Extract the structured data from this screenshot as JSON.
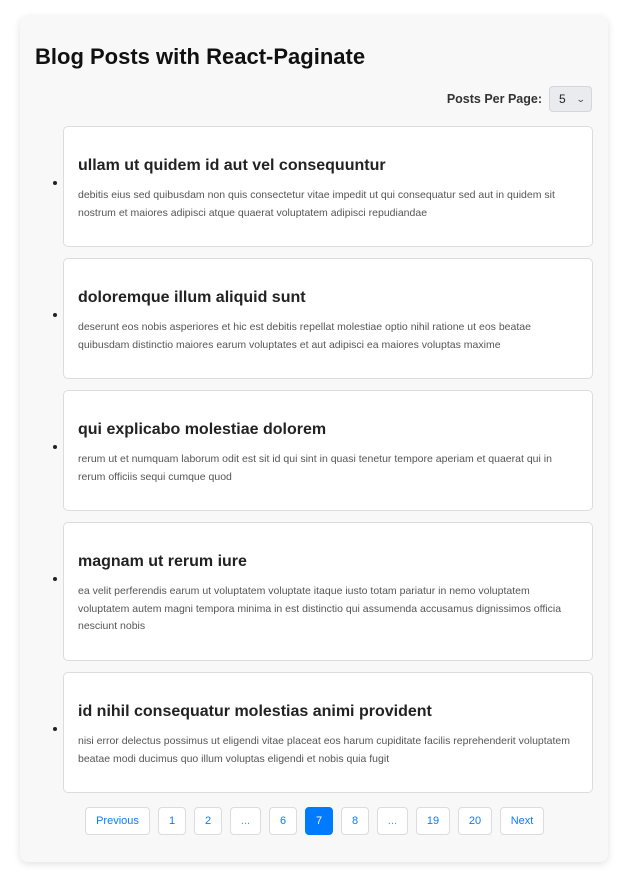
{
  "header": {
    "title": "Blog Posts with React-Paginate"
  },
  "per_page": {
    "label": "Posts Per Page:",
    "selected": "5",
    "chevron_icon": "chevron-down-icon"
  },
  "posts": [
    {
      "title": "ullam ut quidem id aut vel consequuntur",
      "body": "debitis eius sed quibusdam non quis consectetur vitae impedit ut qui consequatur sed aut in quidem sit nostrum et maiores adipisci atque quaerat voluptatem adipisci repudiandae"
    },
    {
      "title": "doloremque illum aliquid sunt",
      "body": "deserunt eos nobis asperiores et hic est debitis repellat molestiae optio nihil ratione ut eos beatae quibusdam distinctio maiores earum voluptates et aut adipisci ea maiores voluptas maxime"
    },
    {
      "title": "qui explicabo molestiae dolorem",
      "body": "rerum ut et numquam laborum odit est sit id qui sint in quasi tenetur tempore aperiam et quaerat qui in rerum officiis sequi cumque quod"
    },
    {
      "title": "magnam ut rerum iure",
      "body": "ea velit perferendis earum ut voluptatem voluptate itaque iusto totam pariatur in nemo voluptatem voluptatem autem magni tempora minima in est distinctio qui assumenda accusamus dignissimos officia nesciunt nobis"
    },
    {
      "title": "id nihil consequatur molestias animi provident",
      "body": "nisi error delectus possimus ut eligendi vitae placeat eos harum cupiditate facilis reprehenderit voluptatem beatae modi ducimus quo illum voluptas eligendi et nobis quia fugit"
    }
  ],
  "pagination": {
    "previous_label": "Previous",
    "next_label": "Next",
    "current_page": "7",
    "pages": [
      "1",
      "2",
      "...",
      "6",
      "7",
      "8",
      "...",
      "19",
      "20"
    ],
    "active_color": "#007bff"
  }
}
